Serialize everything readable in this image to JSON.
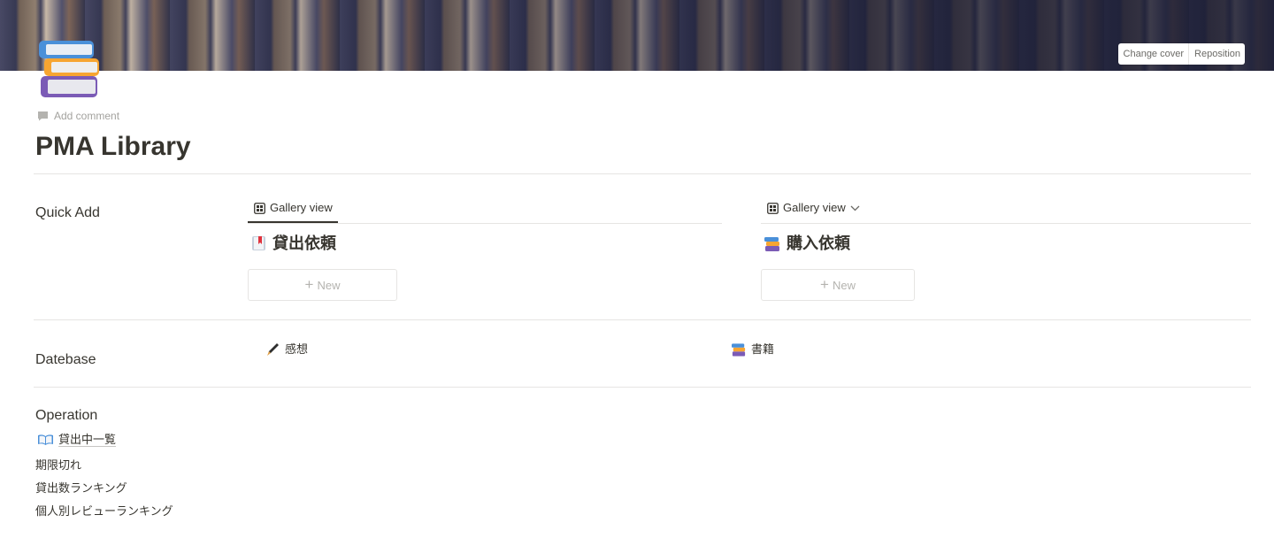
{
  "cover": {
    "change_cover_label": "Change cover",
    "reposition_label": "Reposition"
  },
  "page": {
    "icon": "books-icon",
    "add_comment_label": "Add comment",
    "title": "PMA Library"
  },
  "quick_add": {
    "label": "Quick Add",
    "views": [
      {
        "view_label": "Gallery view",
        "db_title": "貸出依頼",
        "db_icon": "bookmark-icon",
        "new_label": "New"
      },
      {
        "view_label": "Gallery view",
        "db_title": "購入依頼",
        "db_icon": "books-icon",
        "new_label": "New"
      }
    ]
  },
  "database": {
    "label": "Datebase",
    "links": [
      {
        "label": "感想",
        "icon": "pen-icon"
      },
      {
        "label": "書籍",
        "icon": "books-icon"
      }
    ]
  },
  "operation": {
    "label": "Operation",
    "link": {
      "label": "貸出中一覧",
      "icon": "open-book-icon"
    },
    "items": [
      "期限切れ",
      "貸出数ランキング",
      "個人別レビューランキング"
    ]
  },
  "colors": {
    "text": "#37352f",
    "muted": "#a3a29e",
    "divider": "#e6e5e3"
  }
}
